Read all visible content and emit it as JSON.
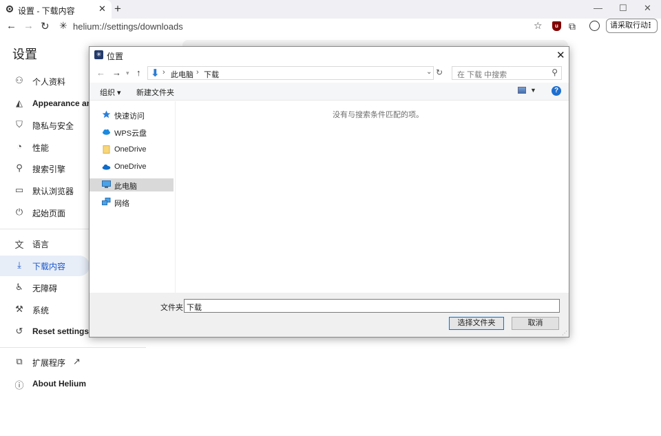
{
  "browser": {
    "tab_title": "设置 - 下载内容",
    "tab_close": "✕",
    "new_tab": "+",
    "window_controls": {
      "minimize": "—",
      "maximize": "☐",
      "close": "✕"
    },
    "url": "helium://settings/downloads",
    "action_button": "请采取行动",
    "action_dots": "⋮",
    "extension_badge": "u"
  },
  "settings": {
    "title": "设置",
    "nav": [
      {
        "label": "个人资料",
        "icon": "person-icon"
      },
      {
        "label": "Appearance and",
        "icon": "appearance-icon"
      },
      {
        "label": "隐私与安全",
        "icon": "shield-icon"
      },
      {
        "label": "性能",
        "icon": "speedometer-icon"
      },
      {
        "label": "搜索引擎",
        "icon": "search-icon"
      },
      {
        "label": "默认浏览器",
        "icon": "browser-window-icon"
      },
      {
        "label": "起始页面",
        "icon": "power-icon"
      },
      {
        "label": "语言",
        "icon": "translate-icon"
      },
      {
        "label": "下载内容",
        "icon": "download-icon"
      },
      {
        "label": "无障碍",
        "icon": "accessibility-icon"
      },
      {
        "label": "系统",
        "icon": "wrench-icon"
      },
      {
        "label": "Reset settings",
        "icon": "reset-icon"
      },
      {
        "label": "扩展程序",
        "icon": "puzzle-icon"
      },
      {
        "label": "About Helium",
        "icon": "info-icon"
      }
    ]
  },
  "dialog": {
    "title": "位置",
    "close": "✕",
    "breadcrumb": [
      "此电脑",
      "下载"
    ],
    "search_placeholder": "在 下载 中搜索",
    "commands": {
      "organize": "组织 ▾",
      "new_folder": "新建文件夹"
    },
    "help": "?",
    "tree": [
      {
        "label": "快速访问",
        "icon": "star-icon"
      },
      {
        "label": "WPS云盘",
        "icon": "cloud-icon"
      },
      {
        "label": "OneDrive",
        "icon": "folder-icon"
      },
      {
        "label": "OneDrive",
        "icon": "onedrive-cloud-icon"
      },
      {
        "label": "此电脑",
        "icon": "computer-icon"
      },
      {
        "label": "网络",
        "icon": "network-icon"
      }
    ],
    "empty_message": "没有与搜索条件匹配的项。",
    "folder_label": "文件夹:",
    "folder_value": "下载",
    "select_button": "选择文件夹",
    "cancel_button": "取消"
  },
  "colors": {
    "accent": "#1a56c8",
    "active_bg": "#e8eef8",
    "dialog_primary_border": "#0078d7"
  }
}
